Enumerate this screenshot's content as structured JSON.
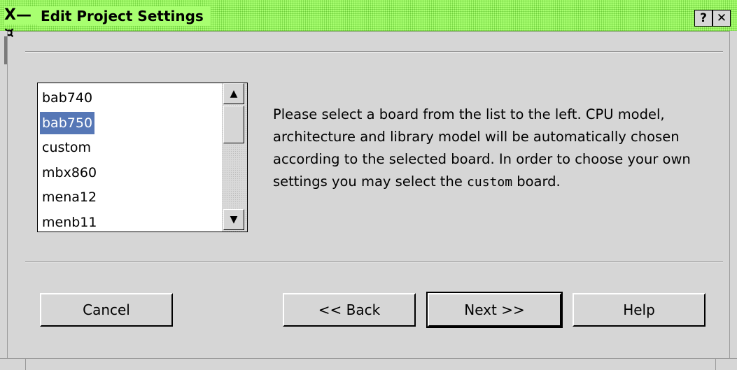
{
  "window": {
    "title": "Edit Project Settings",
    "icon_glyph": "X—¤",
    "help_label": "?",
    "close_label": "✕"
  },
  "boards": {
    "items": [
      "bab740",
      "bab750",
      "custom",
      "mbx860",
      "mena12",
      "menb11"
    ],
    "selected": "bab750"
  },
  "description": {
    "part1": "Please select a board from the list to the left. CPU model, architecture and library model will be automatically chosen according to the selected board. In order to choose your own settings you may select the",
    "code": "custom",
    "part2": "board."
  },
  "buttons": {
    "cancel": "Cancel",
    "back": "<< Back",
    "next": "Next >>",
    "help": "Help"
  },
  "colors": {
    "titlebar": "#a8ff70",
    "selection": "#5677b6",
    "background": "#d6d6d6"
  }
}
